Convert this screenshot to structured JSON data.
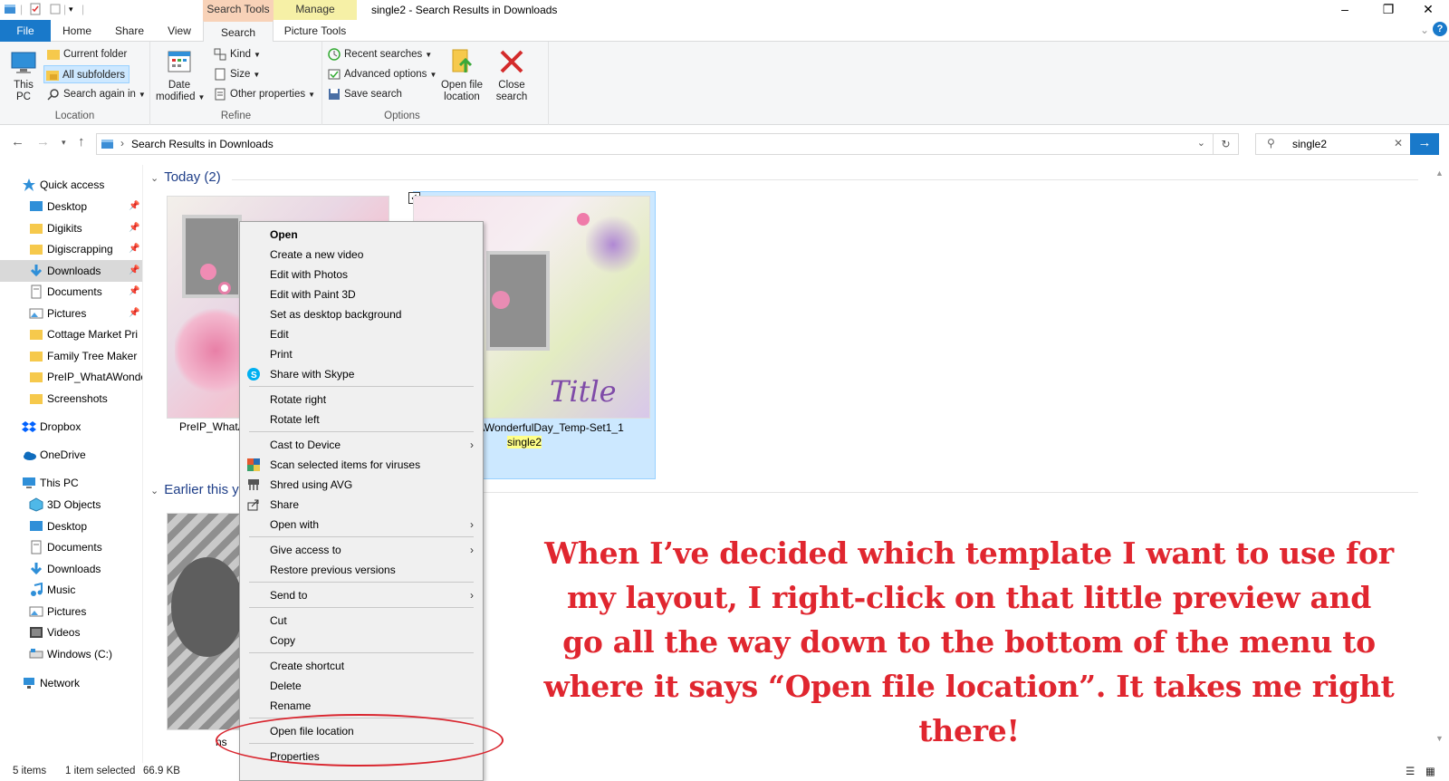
{
  "window": {
    "title": "single2 - Search Results in Downloads",
    "ctx_search_tools": "Search Tools",
    "ctx_manage": "Manage",
    "minimize_icon": "minimize-icon",
    "maximize_icon": "restore-icon",
    "close_icon": "close-icon"
  },
  "tabs": [
    {
      "label": "File"
    },
    {
      "label": "Home"
    },
    {
      "label": "Share"
    },
    {
      "label": "View"
    },
    {
      "label": "Search"
    },
    {
      "label": "Picture Tools"
    }
  ],
  "ribbon": {
    "location": {
      "label": "Location",
      "this_pc": "This PC",
      "current_folder": "Current folder",
      "all_subfolders": "All subfolders",
      "search_again_in": "Search again in"
    },
    "refine": {
      "label": "Refine",
      "date_modified": "Date modified",
      "kind": "Kind",
      "size": "Size",
      "other_properties": "Other properties"
    },
    "options": {
      "label": "Options",
      "recent_searches": "Recent searches",
      "advanced_options": "Advanced options",
      "save_search": "Save search",
      "open_file_location": "Open file location",
      "close_search": "Close search"
    }
  },
  "address": {
    "path": "Search Results in Downloads",
    "search_value": "single2"
  },
  "nav": {
    "quick_access": "Quick access",
    "items": [
      {
        "label": "Desktop",
        "pinned": true
      },
      {
        "label": "Digikits",
        "pinned": true
      },
      {
        "label": "Digiscrapping",
        "pinned": true
      },
      {
        "label": "Downloads",
        "pinned": true,
        "selected": true
      },
      {
        "label": "Documents",
        "pinned": true
      },
      {
        "label": "Pictures",
        "pinned": true
      },
      {
        "label": "Cottage Market Pri"
      },
      {
        "label": "Family Tree Maker"
      },
      {
        "label": "PreIP_WhatAWonde"
      },
      {
        "label": "Screenshots"
      }
    ],
    "dropbox": "Dropbox",
    "onedrive": "OneDrive",
    "this_pc": "This PC",
    "pc_items": [
      {
        "label": "3D Objects"
      },
      {
        "label": "Desktop"
      },
      {
        "label": "Documents"
      },
      {
        "label": "Downloads"
      },
      {
        "label": "Music"
      },
      {
        "label": "Pictures"
      },
      {
        "label": "Videos"
      },
      {
        "label": "Windows (C:)"
      }
    ],
    "network": "Network"
  },
  "content": {
    "group_today": "Today (2)",
    "group_earlier": "Earlier this y",
    "file1_name": "PreIP_WhatA",
    "file2_name_line1": "tAWonderfulDay_Temp-Set1_1",
    "file2_name_line2": "single2",
    "file3_name": "ns",
    "thumb_title_text": "Title"
  },
  "context_menu": {
    "items": [
      {
        "label": "Open",
        "bold": true
      },
      {
        "label": "Create a new video"
      },
      {
        "label": "Edit with Photos"
      },
      {
        "label": "Edit with Paint 3D"
      },
      {
        "label": "Set as desktop background"
      },
      {
        "label": "Edit"
      },
      {
        "label": "Print"
      },
      {
        "label": "Share with Skype",
        "icon": "skype-icon"
      },
      {
        "label": "Rotate right"
      },
      {
        "label": "Rotate left"
      },
      {
        "label": "Cast to Device",
        "submenu": true
      },
      {
        "label": "Scan selected items for viruses",
        "icon": "avast-icon"
      },
      {
        "label": "Shred using AVG",
        "icon": "avg-icon"
      },
      {
        "label": "Share",
        "icon": "share-icon"
      },
      {
        "label": "Open with",
        "submenu": true
      },
      {
        "label": "Give access to",
        "submenu": true
      },
      {
        "label": "Restore previous versions"
      },
      {
        "label": "Send to",
        "submenu": true
      },
      {
        "label": "Cut"
      },
      {
        "label": "Copy"
      },
      {
        "label": "Create shortcut"
      },
      {
        "label": "Delete"
      },
      {
        "label": "Rename"
      },
      {
        "label": "Open file location"
      },
      {
        "label": "Properties"
      }
    ]
  },
  "annotation": {
    "lines": [
      "When I’ve decided which template I want to use for",
      "my layout, I right-click on that little preview and",
      "go all the way down to the bottom of the menu to",
      "where it says “Open file location”. It takes me right there!"
    ],
    "color": "#e0262f"
  },
  "status": {
    "items": "5 items",
    "selected": "1 item selected",
    "size": "66.9 KB"
  },
  "colors": {
    "accent": "#1979ca",
    "search_tools_tab": "#f8d2b8",
    "manage_tab": "#f6f0a6",
    "selection": "#cce8ff"
  }
}
